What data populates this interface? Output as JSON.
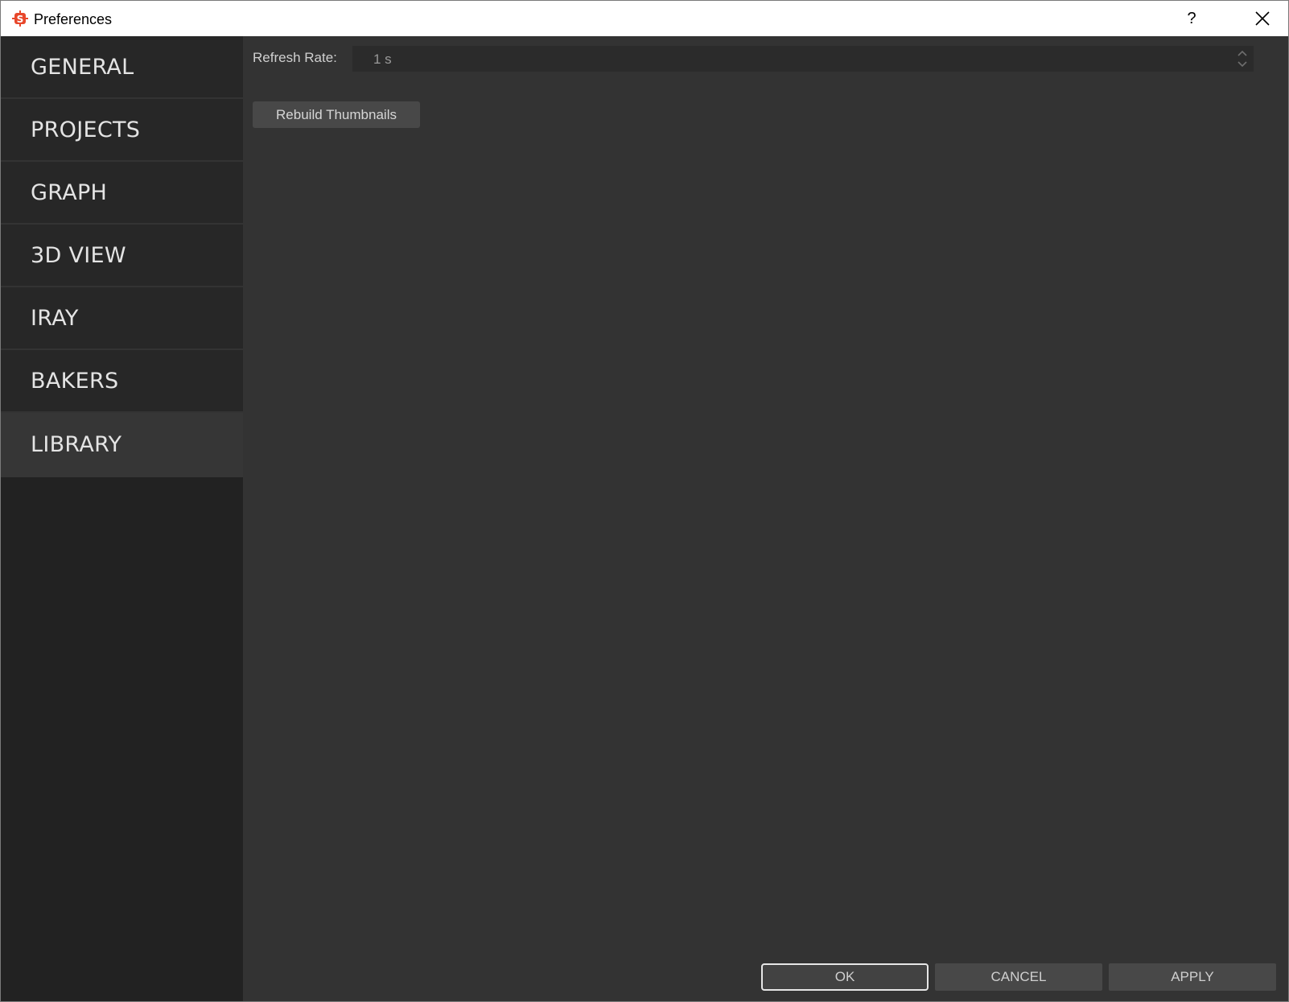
{
  "window": {
    "title": "Preferences",
    "help_label": "?",
    "icons": {
      "app": "substance-logo-icon",
      "close": "close-icon"
    }
  },
  "sidebar": {
    "items": [
      {
        "label": "GENERAL",
        "active": false
      },
      {
        "label": "PROJECTS",
        "active": false
      },
      {
        "label": "GRAPH",
        "active": false
      },
      {
        "label": "3D VIEW",
        "active": false
      },
      {
        "label": "IRAY",
        "active": false
      },
      {
        "label": "BAKERS",
        "active": false
      },
      {
        "label": "LIBRARY",
        "active": true
      }
    ]
  },
  "library": {
    "refresh_rate_label": "Refresh Rate:",
    "refresh_rate_value": "1 s",
    "rebuild_button": "Rebuild Thumbnails"
  },
  "footer": {
    "ok": "OK",
    "cancel": "CANCEL",
    "apply": "APPLY"
  },
  "colors": {
    "accent_logo": "#e8472b",
    "background": "#333333",
    "sidebar": "#222222",
    "active_item": "#363636"
  }
}
